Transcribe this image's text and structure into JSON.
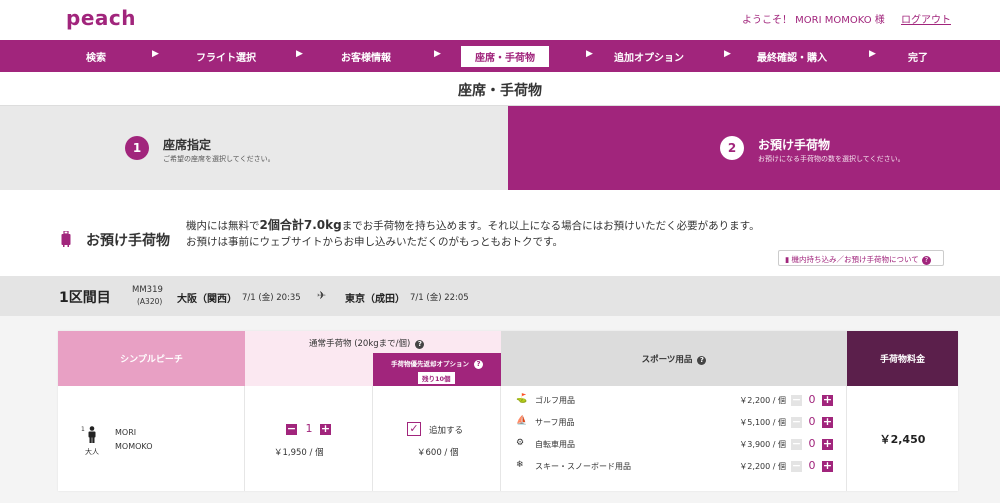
{
  "header": {
    "logo": "peach",
    "welcome": "ようこそ！ MORI MOMOKO 様",
    "logout": "ログアウト"
  },
  "steps": [
    "検索",
    "フライト選択",
    "お客様情報",
    "座席・手荷物",
    "追加オプション",
    "最終確認・購入",
    "完了"
  ],
  "page_title": "座席・手荷物",
  "substeps": [
    {
      "num": "1",
      "title": "座席指定",
      "desc": "ご希望の座席を選択してください。"
    },
    {
      "num": "2",
      "title": "お預け手荷物",
      "desc": "お預けになる手荷物の数を選択してください。"
    }
  ],
  "baggage_info": {
    "title": "お預け手荷物",
    "line1_pre": "機内には無料で",
    "line1_bold": "2個合計7.0kg",
    "line1_post": "までお手荷物を持ち込めます。それ以上になる場合にはお預けいただく必要があります。",
    "line2": "お預けは事前にウェブサイトからお申し込みいただくのがもっともおトクです。",
    "about_link": "機内持ち込み／お預け手荷物について",
    "about_q": "?"
  },
  "segment": {
    "label": "1区間目",
    "flight_no": "MM319",
    "aircraft": "(A320)",
    "dep_city": "大阪（関西）",
    "dep_time": "7/1 (金) 20:35",
    "arr_city": "東京（成田）",
    "arr_time": "7/1 (金) 22:05"
  },
  "table": {
    "fare_header": "シンプルピーチ",
    "normal_header": "通常手荷物 (20kgまで/個)",
    "priority_header": "手荷物優先返却オプション",
    "priority_remaining": "残り10個",
    "sports_header": "スポーツ用品",
    "total_header": "手荷物料金",
    "q": "?",
    "passenger": {
      "num": "1",
      "type": "大人",
      "last_name": "MORI",
      "first_name": "MOMOKO"
    },
    "normal": {
      "qty": "1",
      "price": "￥1,950 / 個",
      "minus": "−",
      "plus": "+"
    },
    "priority": {
      "checked": "✓",
      "label": "追加する",
      "price": "￥600 / 個"
    },
    "sports": [
      {
        "icon": "golf-bag-icon",
        "glyph": "⛳",
        "name": "ゴルフ用品",
        "price": "￥2,200 / 個",
        "qty": "0"
      },
      {
        "icon": "surfboard-icon",
        "glyph": "🏄",
        "name": "サーフ用品",
        "price": "￥5,100 / 個",
        "qty": "0"
      },
      {
        "icon": "bicycle-icon",
        "glyph": "🚲",
        "name": "自転車用品",
        "price": "￥3,900 / 個",
        "qty": "0"
      },
      {
        "icon": "ski-icon",
        "glyph": "⛷",
        "name": "スキー・スノーボード用品",
        "price": "￥2,200 / 個",
        "qty": "0"
      }
    ],
    "total": "￥2,450"
  },
  "colors": {
    "brand": "#a1257c",
    "total_header": "#5b1f4b",
    "fare_header": "#e8a0c4"
  }
}
